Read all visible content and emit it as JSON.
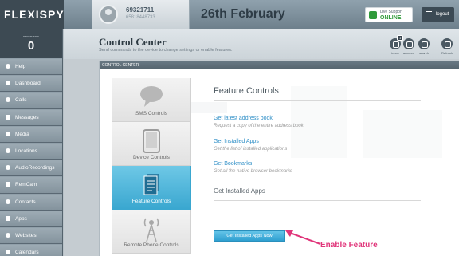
{
  "app": {
    "logo_text": "FLEXISPY"
  },
  "device": {
    "phone_number": "69321711",
    "imei": "65818448733"
  },
  "header": {
    "date_title": "26th February"
  },
  "live_support": {
    "label": "Live Support",
    "status": "ONLINE"
  },
  "logout": {
    "label": "logout"
  },
  "sidebar": {
    "counter_label": "new events",
    "counter_value": "0",
    "items": [
      {
        "label": "Help",
        "icon": "help-icon"
      },
      {
        "label": "Dashboard",
        "icon": "dashboard-icon"
      },
      {
        "label": "Calls",
        "icon": "phone-icon"
      },
      {
        "label": "Messages",
        "icon": "message-icon"
      },
      {
        "label": "Media",
        "icon": "media-icon"
      },
      {
        "label": "Locations",
        "icon": "location-icon"
      },
      {
        "label": "AudioRecordings",
        "icon": "audio-icon"
      },
      {
        "label": "RemCam",
        "icon": "camera-icon"
      },
      {
        "label": "Contacts",
        "icon": "contacts-icon"
      },
      {
        "label": "Apps",
        "icon": "apps-icon"
      },
      {
        "label": "Websites",
        "icon": "globe-icon"
      },
      {
        "label": "Calendars",
        "icon": "calendar-icon"
      }
    ]
  },
  "control_center": {
    "title": "Control Center",
    "subtitle": "Send commands to the device to change settings or enable features.",
    "panel_bar": "CONTROL CENTER",
    "tools": [
      {
        "label": "inbox",
        "badge": "1",
        "icon": "inbox-icon"
      },
      {
        "label": "account",
        "badge": "",
        "icon": "account-icon"
      },
      {
        "label": "search",
        "badge": "",
        "icon": "search-icon"
      },
      {
        "label": "Refresh",
        "badge": "",
        "icon": "refresh-icon"
      }
    ]
  },
  "tabs": [
    {
      "label": "SMS Controls",
      "icon": "speech-bubble-icon",
      "active": false
    },
    {
      "label": "Device Controls",
      "icon": "device-icon",
      "active": false
    },
    {
      "label": "Feature Controls",
      "icon": "document-icon",
      "active": true
    },
    {
      "label": "Remote Phone Controls",
      "icon": "antenna-icon",
      "active": false
    }
  ],
  "feature_controls": {
    "title": "Feature Controls",
    "features": [
      {
        "link": "Get latest address book",
        "description": "Request a copy of the entire address book"
      },
      {
        "link": "Get Installed Apps",
        "description": "Get the list of installed applications"
      },
      {
        "link": "Get Bookmarks",
        "description": "Get all the native browser bookmarks"
      }
    ],
    "section_title": "Get Installed Apps",
    "action_button": "Get Installed Apps Now"
  },
  "annotation": {
    "text": "Enable Feature",
    "color": "#e0357a"
  },
  "colors": {
    "accent_blue": "#3aa7d0",
    "link_blue": "#2f8fc7",
    "online_green": "#2f9a3a",
    "sidebar_gray": "#8e9ca6"
  }
}
